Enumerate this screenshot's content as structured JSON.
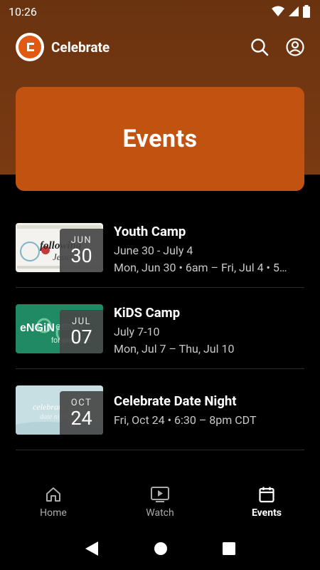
{
  "status_bar": {
    "time": "10:26"
  },
  "app": {
    "title": "Celebrate"
  },
  "hero": {
    "title": "Events"
  },
  "events": [
    {
      "title": "Youth Camp",
      "line1": "June 30 - July 4",
      "line2": "Mon, Jun 30 • 6am – Fri, Jul 4 • 5…",
      "month": "JUN",
      "day": "30",
      "thumb_text": "following Jesus"
    },
    {
      "title": "KiDS Camp",
      "line1": "July 7-10",
      "line2": "Mon, Jul 7 – Thu, Jul 10",
      "month": "JUL",
      "day": "07",
      "thumb_text": "engineered for purpose"
    },
    {
      "title": "Celebrate Date Night",
      "line1": "Fri, Oct 24 • 6:30 – 8pm CDT",
      "line2": "",
      "month": "OCT",
      "day": "24",
      "thumb_text": "celebrate date"
    }
  ],
  "bottom_nav": [
    {
      "label": "Home",
      "icon": "home-icon",
      "active": false
    },
    {
      "label": "Watch",
      "icon": "watch-icon",
      "active": false
    },
    {
      "label": "Events",
      "icon": "calendar-icon",
      "active": true
    }
  ],
  "colors": {
    "accent": "#c1520f",
    "header": "#6a3310"
  }
}
